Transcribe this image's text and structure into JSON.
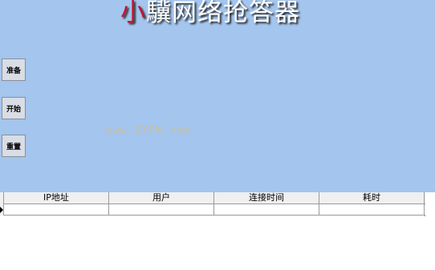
{
  "window": {
    "title_first_char": "小",
    "title_rest": "驥网络抢答器"
  },
  "controls": {
    "prepare_label": "准备",
    "start_label": "开始",
    "reset_label": "重置"
  },
  "watermark": "www.9XPW.com",
  "colors": {
    "panel_background": "#a3c5ee",
    "title_accent": "#c8102e"
  },
  "grid": {
    "columns": [
      "IP地址",
      "用户",
      "连接时间",
      "耗时"
    ],
    "rows": [
      [
        "",
        "",
        "",
        ""
      ]
    ]
  }
}
